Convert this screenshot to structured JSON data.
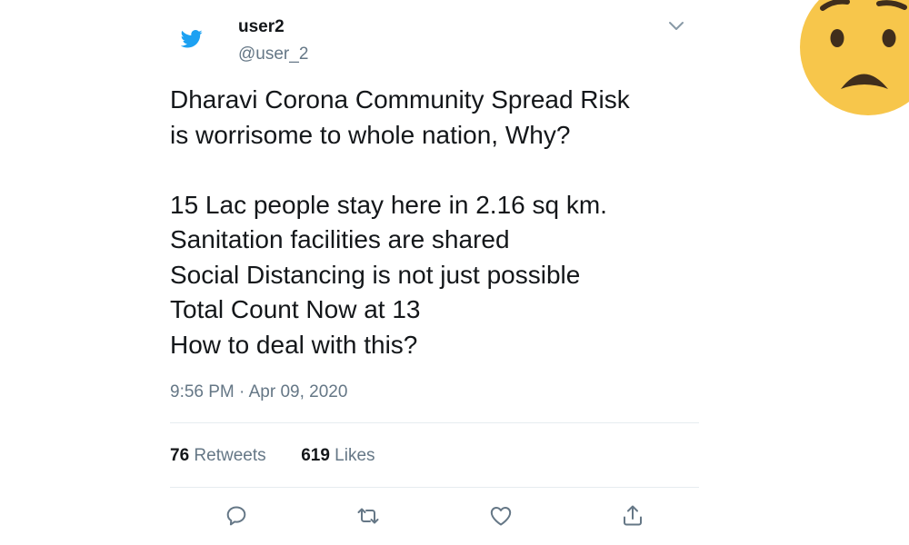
{
  "tweet": {
    "username": "user2",
    "handle": "@user_2",
    "lines": [
      "Dharavi Corona Community Spread Risk",
      "is worrisome to whole nation, Why?",
      "",
      "15 Lac people stay here in 2.16 sq km.",
      "Sanitation facilities are shared",
      "Social Distancing is not just possible",
      "Total Count Now at 13",
      "How to deal with this?"
    ],
    "timestamp": "9:56 PM · Apr 09, 2020",
    "retweets_count": "76",
    "retweets_label": "Retweets",
    "likes_count": "619",
    "likes_label": "Likes"
  },
  "icons": {
    "logo": "twitter-bird-icon",
    "menu": "chevron-down-icon",
    "actions": [
      "reply-icon",
      "retweet-icon",
      "like-icon",
      "share-icon"
    ],
    "emoji": "anguished-face-emoji"
  },
  "colors": {
    "brand": "#1da1f2",
    "text": "#14171a",
    "secondary": "#657786",
    "divider": "#e6ecf0",
    "emoji_face": "#f7c64b"
  }
}
